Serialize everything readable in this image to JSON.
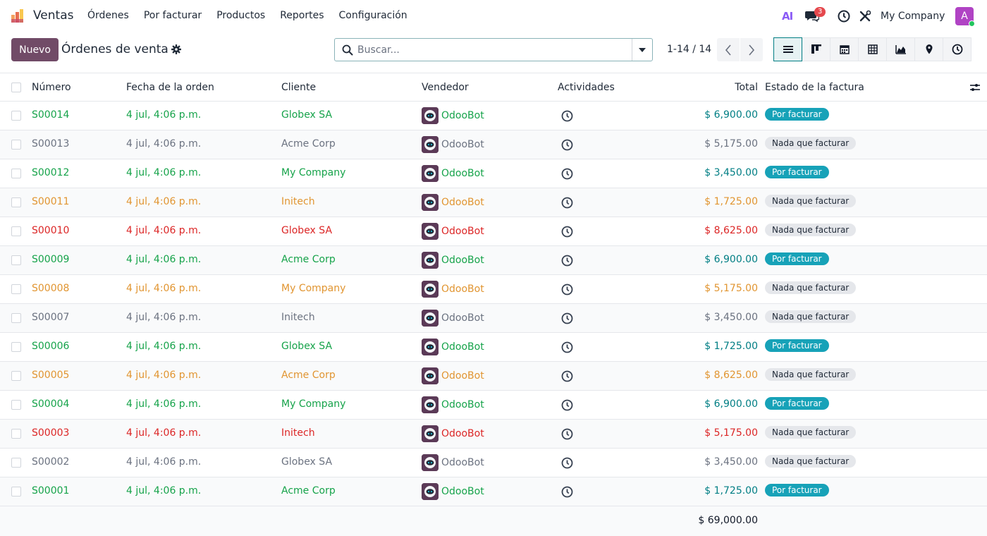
{
  "navbar": {
    "app_name": "Ventas",
    "menu": [
      "Órdenes",
      "Por facturar",
      "Productos",
      "Reportes",
      "Configuración"
    ],
    "ai_label": "AI",
    "chat_count": "3",
    "company": "My Company",
    "user_initial": "A"
  },
  "control": {
    "new_label": "Nuevo",
    "title": "Órdenes de venta",
    "search_placeholder": "Buscar...",
    "pager": "1-14 / 14",
    "views": [
      "list-view-icon",
      "kanban-view-icon",
      "calendar-view-icon",
      "pivot-view-icon",
      "graph-view-icon",
      "map-view-icon",
      "activity-view-icon"
    ],
    "active_view": "list-view-icon"
  },
  "table": {
    "headers": {
      "number": "Número",
      "date": "Fecha de la orden",
      "client": "Cliente",
      "seller": "Vendedor",
      "activities": "Actividades",
      "total": "Total",
      "invoice_status": "Estado de la factura"
    },
    "rows": [
      {
        "number": "S00014",
        "date": "4 jul, 4:06 p.m.",
        "client": "Globex SA",
        "seller": "OdooBot",
        "total": "$ 6,900.00",
        "status": "Por facturar",
        "tone": "green"
      },
      {
        "number": "S00013",
        "date": "4 jul, 4:06 p.m.",
        "client": "Acme Corp",
        "seller": "OdooBot",
        "total": "$ 5,175.00",
        "status": "Nada que facturar",
        "tone": "gray"
      },
      {
        "number": "S00012",
        "date": "4 jul, 4:06 p.m.",
        "client": "My Company",
        "seller": "OdooBot",
        "total": "$ 3,450.00",
        "status": "Por facturar",
        "tone": "green"
      },
      {
        "number": "S00011",
        "date": "4 jul, 4:06 p.m.",
        "client": "Initech",
        "seller": "OdooBot",
        "total": "$ 1,725.00",
        "status": "Nada que facturar",
        "tone": "orange"
      },
      {
        "number": "S00010",
        "date": "4 jul, 4:06 p.m.",
        "client": "Globex SA",
        "seller": "OdooBot",
        "total": "$ 8,625.00",
        "status": "Nada que facturar",
        "tone": "red"
      },
      {
        "number": "S00009",
        "date": "4 jul, 4:06 p.m.",
        "client": "Acme Corp",
        "seller": "OdooBot",
        "total": "$ 6,900.00",
        "status": "Por facturar",
        "tone": "green"
      },
      {
        "number": "S00008",
        "date": "4 jul, 4:06 p.m.",
        "client": "My Company",
        "seller": "OdooBot",
        "total": "$ 5,175.00",
        "status": "Nada que facturar",
        "tone": "orange"
      },
      {
        "number": "S00007",
        "date": "4 jul, 4:06 p.m.",
        "client": "Initech",
        "seller": "OdooBot",
        "total": "$ 3,450.00",
        "status": "Nada que facturar",
        "tone": "gray"
      },
      {
        "number": "S00006",
        "date": "4 jul, 4:06 p.m.",
        "client": "Globex SA",
        "seller": "OdooBot",
        "total": "$ 1,725.00",
        "status": "Por facturar",
        "tone": "green"
      },
      {
        "number": "S00005",
        "date": "4 jul, 4:06 p.m.",
        "client": "Acme Corp",
        "seller": "OdooBot",
        "total": "$ 8,625.00",
        "status": "Nada que facturar",
        "tone": "orange"
      },
      {
        "number": "S00004",
        "date": "4 jul, 4:06 p.m.",
        "client": "My Company",
        "seller": "OdooBot",
        "total": "$ 6,900.00",
        "status": "Por facturar",
        "tone": "green"
      },
      {
        "number": "S00003",
        "date": "4 jul, 4:06 p.m.",
        "client": "Initech",
        "seller": "OdooBot",
        "total": "$ 5,175.00",
        "status": "Nada que facturar",
        "tone": "red"
      },
      {
        "number": "S00002",
        "date": "4 jul, 4:06 p.m.",
        "client": "Globex SA",
        "seller": "OdooBot",
        "total": "$ 3,450.00",
        "status": "Nada que facturar",
        "tone": "gray"
      },
      {
        "number": "S00001",
        "date": "4 jul, 4:06 p.m.",
        "client": "Acme Corp",
        "seller": "OdooBot",
        "total": "$ 1,725.00",
        "status": "Por facturar",
        "tone": "green"
      }
    ],
    "grand_total": "$ 69,000.00"
  },
  "colors": {
    "brand": "#714b67",
    "accent": "#017e84",
    "green": "#16a34a",
    "orange": "#e19531",
    "red": "#dc2626",
    "gray": "#6b7280",
    "badge_info": "#17a2b8"
  }
}
